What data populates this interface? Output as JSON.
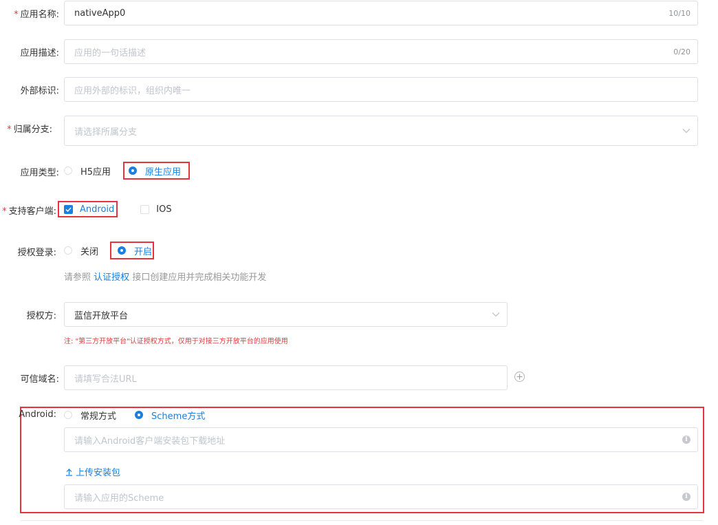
{
  "form": {
    "app_name": {
      "label": "应用名称:",
      "value": "nativeApp0",
      "counter": "10/10"
    },
    "app_desc": {
      "label": "应用描述:",
      "placeholder": "应用的一句话描述",
      "counter": "0/20"
    },
    "external_id": {
      "label": "外部标识:",
      "placeholder": "应用外部的标识，组织内唯一"
    },
    "branch": {
      "label": "归属分支:",
      "placeholder": "请选择所属分支"
    },
    "app_type": {
      "label": "应用类型:",
      "options": [
        "H5应用",
        "原生应用"
      ],
      "selected": "原生应用"
    },
    "clients": {
      "label": "支持客户端:",
      "options": [
        "Android",
        "IOS"
      ],
      "checked": [
        "Android"
      ]
    },
    "auth_login": {
      "label": "授权登录:",
      "options": [
        "关闭",
        "开启"
      ],
      "selected": "开启"
    },
    "auth_hint": {
      "prefix": "请参照",
      "link": "认证授权",
      "suffix": "接口创建应用并完成相关功能开发"
    },
    "auth_provider": {
      "label": "授权方:",
      "value": "蓝信开放平台",
      "note": "注: \"第三方开放平台\"认证授权方式，仅用于对接三方开放平台的应用使用"
    },
    "trusted_domain": {
      "label": "可信域名:",
      "placeholder": "请填写合法URL"
    },
    "android": {
      "label": "Android:",
      "options": [
        "常规方式",
        "Scheme方式"
      ],
      "selected": "Scheme方式",
      "download_placeholder": "请输入Android客户端安装包下载地址",
      "upload_label": "上传安装包",
      "scheme_placeholder": "请输入应用的Scheme"
    }
  },
  "colors": {
    "primary": "#1a7fe0",
    "required": "#e23b3b",
    "highlight": "#e8323f",
    "note": "#e03a3a"
  }
}
